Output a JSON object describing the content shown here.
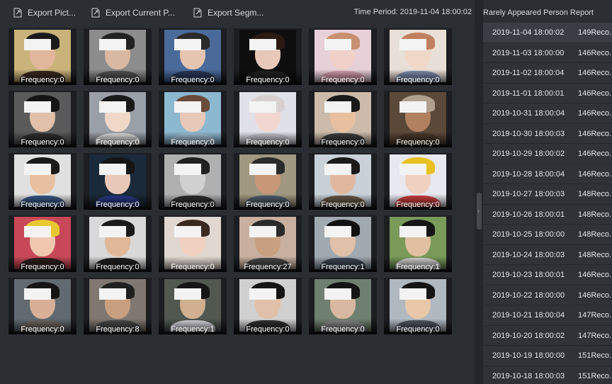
{
  "toolbar": {
    "export_picture": "Export Pict...",
    "export_current": "Export Current P...",
    "export_segment": "Export Segm...",
    "time_period": "Time Period: 2019-11-04 18:00:02"
  },
  "report": {
    "title": "Rarely Appeared Person Report",
    "rows": [
      {
        "datetime": "2019-11-04 18:00:02",
        "records": "149Reco..."
      },
      {
        "datetime": "2019-11-03 18:00:00",
        "records": "146Reco..."
      },
      {
        "datetime": "2019-11-02 18:00:04",
        "records": "146Reco..."
      },
      {
        "datetime": "2019-11-01 18:00:01",
        "records": "146Reco..."
      },
      {
        "datetime": "2019-10-31 18:00:04",
        "records": "146Reco..."
      },
      {
        "datetime": "2019-10-30 18:00:03",
        "records": "146Reco..."
      },
      {
        "datetime": "2019-10-29 18:00:02",
        "records": "146Reco..."
      },
      {
        "datetime": "2019-10-28 18:00:04",
        "records": "146Reco..."
      },
      {
        "datetime": "2019-10-27 18:00:03",
        "records": "148Reco..."
      },
      {
        "datetime": "2019-10-26 18:00:01",
        "records": "148Reco..."
      },
      {
        "datetime": "2019-10-25 18:00:00",
        "records": "148Reco..."
      },
      {
        "datetime": "2019-10-24 18:00:03",
        "records": "148Reco..."
      },
      {
        "datetime": "2019-10-23 18:00:01",
        "records": "146Reco..."
      },
      {
        "datetime": "2019-10-22 18:00:00",
        "records": "146Reco..."
      },
      {
        "datetime": "2019-10-21 18:00:04",
        "records": "147Reco..."
      },
      {
        "datetime": "2019-10-20 18:00:02",
        "records": "147Reco..."
      },
      {
        "datetime": "2019-10-19 18:00:00",
        "records": "151Reco..."
      },
      {
        "datetime": "2019-10-18 18:00:03",
        "records": "151Reco..."
      }
    ]
  },
  "grid": {
    "tiles": [
      {
        "frequency": "Frequency:0"
      },
      {
        "frequency": "Frequency:0"
      },
      {
        "frequency": "Frequency:0"
      },
      {
        "frequency": "Frequency:0"
      },
      {
        "frequency": "Frequency:0"
      },
      {
        "frequency": "Frequency:0"
      },
      {
        "frequency": "Frequency:0"
      },
      {
        "frequency": "Frequency:0"
      },
      {
        "frequency": "Frequency:0"
      },
      {
        "frequency": "Frequency:0"
      },
      {
        "frequency": "Frequency:0"
      },
      {
        "frequency": "Frequency:0"
      },
      {
        "frequency": "Frequency:0"
      },
      {
        "frequency": "Frequency:0"
      },
      {
        "frequency": "Frequency:0"
      },
      {
        "frequency": "Frequency:0"
      },
      {
        "frequency": "Frequency:0"
      },
      {
        "frequency": "Frequency:0"
      },
      {
        "frequency": "Frequency:0"
      },
      {
        "frequency": "Frequency:0"
      },
      {
        "frequency": "Frequency:0"
      },
      {
        "frequency": "Frequency:27"
      },
      {
        "frequency": "Frequency:1"
      },
      {
        "frequency": "Frequency:1"
      },
      {
        "frequency": "Frequency:0"
      },
      {
        "frequency": "Frequency:8"
      },
      {
        "frequency": "Frequency:1"
      },
      {
        "frequency": "Frequency:0"
      },
      {
        "frequency": "Frequency:0"
      },
      {
        "frequency": "Frequency:0"
      }
    ]
  }
}
